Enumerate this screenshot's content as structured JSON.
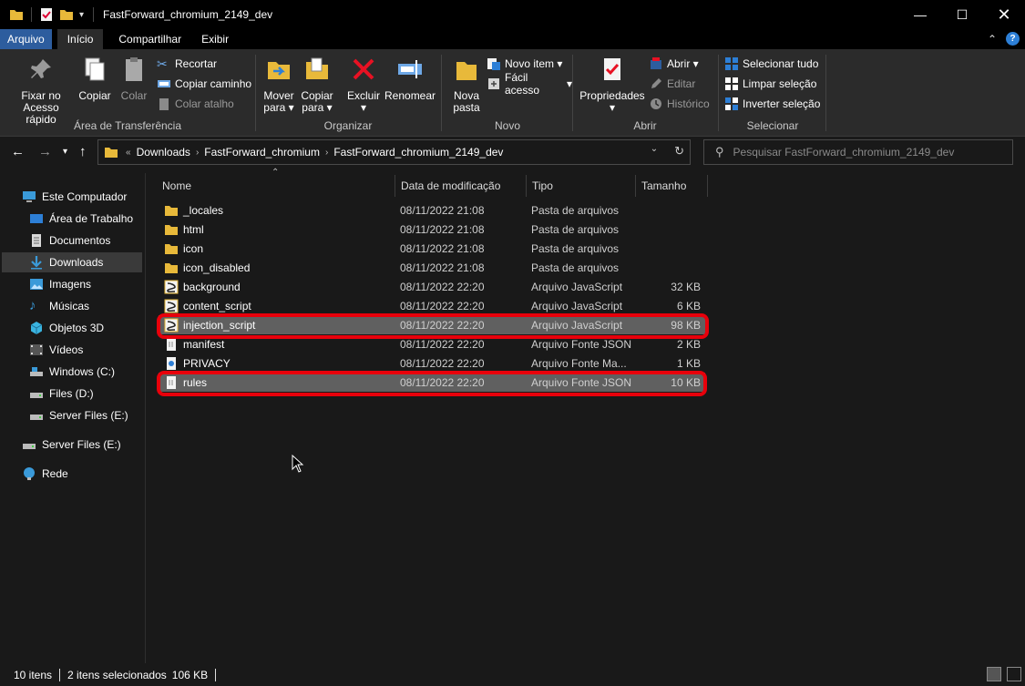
{
  "window": {
    "title": "FastForward_chromium_2149_dev",
    "controls": [
      "minimize",
      "maximize",
      "close"
    ]
  },
  "ribbon_tabs": [
    {
      "label": "Arquivo"
    },
    {
      "label": "Início"
    },
    {
      "label": "Compartilhar"
    },
    {
      "label": "Exibir"
    }
  ],
  "ribbon": {
    "clipboard": {
      "label": "Área de Transferência",
      "pin": "Fixar no Acesso rápido",
      "pin_l1": "Fixar no",
      "pin_l2": "Acesso rápido",
      "copy": "Copiar",
      "paste": "Colar",
      "cut": "Recortar",
      "copy_path": "Copiar caminho",
      "paste_shortcut": "Colar atalho"
    },
    "organize": {
      "label": "Organizar",
      "move_l1": "Mover",
      "move_l2": "para",
      "copy_l1": "Copiar",
      "copy_l2": "para",
      "delete": "Excluir",
      "rename": "Renomear"
    },
    "new": {
      "label": "Novo",
      "new_folder_l1": "Nova",
      "new_folder_l2": "pasta",
      "new_item": "Novo item",
      "easy_access": "Fácil acesso"
    },
    "open": {
      "label": "Abrir",
      "properties": "Propriedades",
      "open": "Abrir",
      "edit": "Editar",
      "history": "Histórico"
    },
    "select": {
      "label": "Selecionar",
      "select_all": "Selecionar tudo",
      "select_none": "Limpar seleção",
      "invert": "Inverter seleção"
    }
  },
  "address": {
    "crumbs": [
      "Downloads",
      "FastForward_chromium",
      "FastForward_chromium_2149_dev"
    ],
    "overflow": "«"
  },
  "search": {
    "placeholder": "Pesquisar FastForward_chromium_2149_dev"
  },
  "sidebar": {
    "items": [
      {
        "label": "Este Computador",
        "icon": "computer-icon"
      },
      {
        "label": "Área de Trabalho",
        "icon": "desktop-icon"
      },
      {
        "label": "Documentos",
        "icon": "documents-icon"
      },
      {
        "label": "Downloads",
        "icon": "downloads-icon",
        "selected": true
      },
      {
        "label": "Imagens",
        "icon": "pictures-icon"
      },
      {
        "label": "Músicas",
        "icon": "music-icon"
      },
      {
        "label": "Objetos 3D",
        "icon": "3d-objects-icon"
      },
      {
        "label": "Vídeos",
        "icon": "videos-icon"
      },
      {
        "label": "Windows (C:)",
        "icon": "drive-c-icon"
      },
      {
        "label": "Files (D:)",
        "icon": "drive-icon"
      },
      {
        "label": "Server Files (E:)",
        "icon": "drive-icon"
      },
      {
        "label": "Server Files (E:)",
        "icon": "drive-icon"
      },
      {
        "label": "Rede",
        "icon": "network-icon"
      }
    ]
  },
  "columns": {
    "name": "Nome",
    "date": "Data de modificação",
    "type": "Tipo",
    "size": "Tamanho"
  },
  "files": [
    {
      "name": "_locales",
      "date": "08/11/2022 21:08",
      "type": "Pasta de arquivos",
      "size": "",
      "kind": "folder"
    },
    {
      "name": "html",
      "date": "08/11/2022 21:08",
      "type": "Pasta de arquivos",
      "size": "",
      "kind": "folder"
    },
    {
      "name": "icon",
      "date": "08/11/2022 21:08",
      "type": "Pasta de arquivos",
      "size": "",
      "kind": "folder"
    },
    {
      "name": "icon_disabled",
      "date": "08/11/2022 21:08",
      "type": "Pasta de arquivos",
      "size": "",
      "kind": "folder"
    },
    {
      "name": "background",
      "date": "08/11/2022 22:20",
      "type": "Arquivo JavaScript",
      "size": "32 KB",
      "kind": "js"
    },
    {
      "name": "content_script",
      "date": "08/11/2022 22:20",
      "type": "Arquivo JavaScript",
      "size": "6 KB",
      "kind": "js"
    },
    {
      "name": "injection_script",
      "date": "08/11/2022 22:20",
      "type": "Arquivo JavaScript",
      "size": "98 KB",
      "kind": "js",
      "selected": true
    },
    {
      "name": "manifest",
      "date": "08/11/2022 22:20",
      "type": "Arquivo Fonte JSON",
      "size": "2 KB",
      "kind": "json"
    },
    {
      "name": "PRIVACY",
      "date": "08/11/2022 22:20",
      "type": "Arquivo Fonte Ma...",
      "size": "1 KB",
      "kind": "md"
    },
    {
      "name": "rules",
      "date": "08/11/2022 22:20",
      "type": "Arquivo Fonte JSON",
      "size": "10 KB",
      "kind": "json",
      "selected": true
    }
  ],
  "status": {
    "count": "10 itens",
    "selection": "2 itens selecionados",
    "selection_size": "106 KB"
  },
  "colors": {
    "highlight": "#e8000b",
    "selected_row": "#606060",
    "file_tab": "#2d5d9e"
  }
}
